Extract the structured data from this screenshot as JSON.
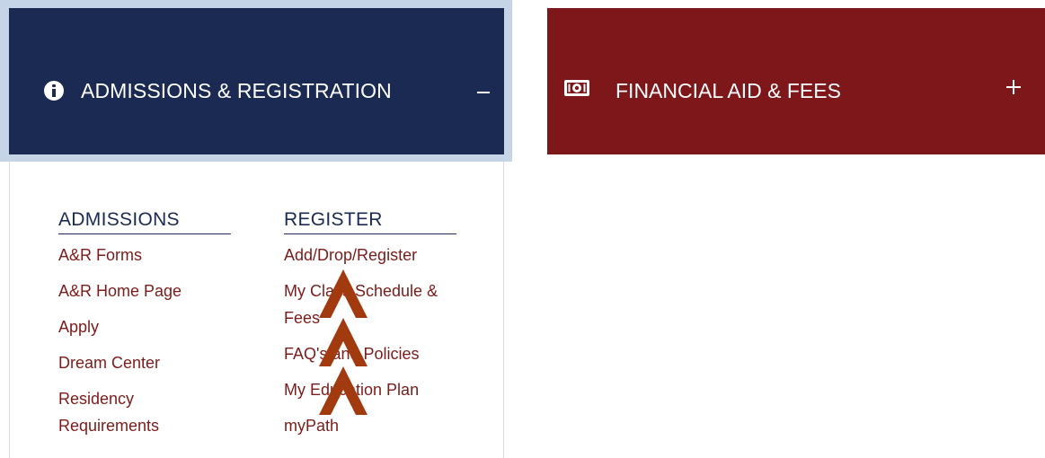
{
  "admissions_panel": {
    "title": "ADMISSIONS & REGISTRATION",
    "icon": "info-icon",
    "toggle": "minus",
    "header_bg": "#1a2a52",
    "columns": {
      "admissions": {
        "heading": "ADMISSIONS",
        "links": [
          "A&R Forms",
          "A&R Home Page",
          "Apply",
          "Dream Center",
          "Residency Requirements"
        ]
      },
      "register": {
        "heading": "REGISTER",
        "links": [
          "Add/Drop/Register",
          "My Class Schedule & Fees",
          "FAQ's and Policies",
          "My Education Plan",
          "myPath"
        ]
      }
    }
  },
  "financial_panel": {
    "title": "FINANCIAL AID & FEES",
    "icon": "money-icon",
    "toggle": "plus",
    "header_bg": "#7d171a"
  },
  "colors": {
    "link": "#7a1c1a",
    "heading": "#1a2a52",
    "overlay_arrows": "#a23a10"
  }
}
